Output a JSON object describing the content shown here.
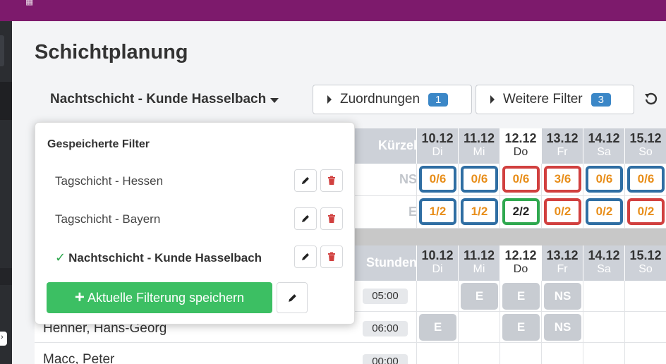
{
  "page": {
    "title": "Schichtplanung"
  },
  "filter": {
    "current": "Nachtschicht - Kunde Hasselbach"
  },
  "toolbar": {
    "assignments_label": "Zuordnungen",
    "assignments_count": "1",
    "more_filters_label": "Weitere Filter",
    "more_filters_count": "3"
  },
  "dropdown": {
    "heading": "Gespeicherte Filter",
    "items": [
      {
        "label": "Tagschicht - Hessen",
        "active": false
      },
      {
        "label": "Tagschicht - Bayern",
        "active": false
      },
      {
        "label": "Nachtschicht - Kunde Hasselbach",
        "active": true
      }
    ],
    "save_label": "Aktuelle Filterung speichern"
  },
  "summary": {
    "column_title": "Kürzel",
    "days": [
      {
        "date": "10.12",
        "weekday": "Di"
      },
      {
        "date": "11.12",
        "weekday": "Mi"
      },
      {
        "date": "12.12",
        "weekday": "Do"
      },
      {
        "date": "13.12",
        "weekday": "Fr"
      },
      {
        "date": "14.12",
        "weekday": "Sa"
      },
      {
        "date": "15.12",
        "weekday": "So"
      }
    ],
    "rows": [
      {
        "abbr": "NS",
        "cells": [
          "0/6",
          "0/6",
          "0/6",
          "3/6",
          "0/6",
          "0/6"
        ]
      },
      {
        "abbr": "E",
        "cells": [
          "1/2",
          "1/2",
          "2/2",
          "0/2",
          "0/2",
          "0/2"
        ]
      }
    ]
  },
  "employees": {
    "column_title": "Stunden",
    "days": [
      {
        "date": "10.12",
        "weekday": "Di"
      },
      {
        "date": "11.12",
        "weekday": "Mi"
      },
      {
        "date": "12.12",
        "weekday": "Do"
      },
      {
        "date": "13.12",
        "weekday": "Fr"
      },
      {
        "date": "14.12",
        "weekday": "Sa"
      },
      {
        "date": "15.12",
        "weekday": "So"
      }
    ],
    "rows": [
      {
        "name": "",
        "hours": "05:00",
        "shifts": [
          "",
          "E",
          "E",
          "NS",
          "",
          ""
        ]
      },
      {
        "name": "Henner, Hans-Georg",
        "hours": "06:00",
        "shifts": [
          "E",
          "",
          "E",
          "NS",
          "",
          ""
        ]
      },
      {
        "name": "Macc, Peter",
        "hours": "00:00",
        "shifts": [
          "",
          "",
          "",
          "",
          "",
          ""
        ]
      }
    ]
  },
  "colors": {
    "topbar": "#7d1a6c",
    "blue_border": "#2f6ea3",
    "red_border": "#d1403f",
    "green_border": "#2fa84f",
    "count_text": "#e88e1a",
    "save_button": "#3cbf63",
    "badge": "#3b87c7"
  }
}
